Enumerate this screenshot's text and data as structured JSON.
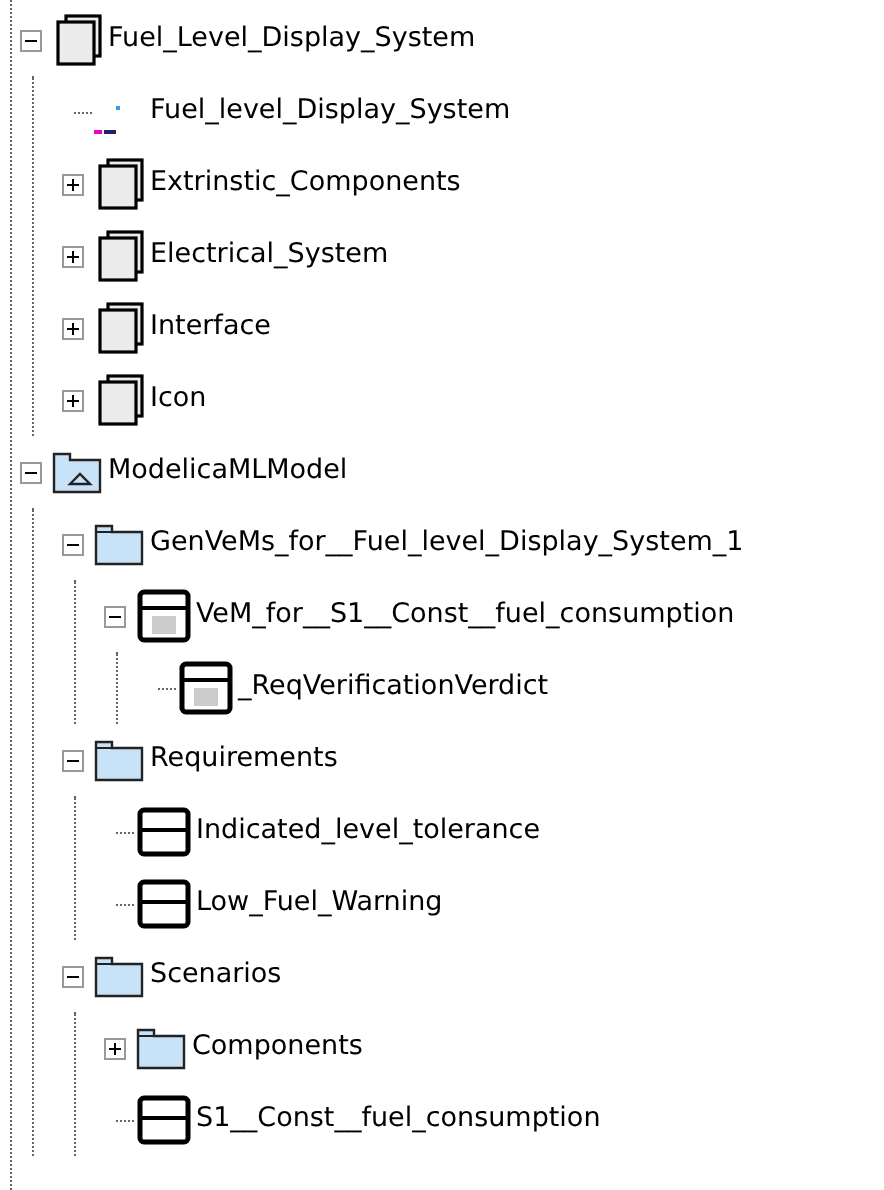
{
  "tree": [
    {
      "label": "Fuel_Level_Display_System",
      "kind": "stack",
      "expanded": true,
      "children": [
        {
          "label": "Fuel_level_Display_System",
          "kind": "diagram"
        },
        {
          "label": "Extrinstic_Components",
          "kind": "stack",
          "expanded": false
        },
        {
          "label": "Electrical_System",
          "kind": "stack",
          "expanded": false
        },
        {
          "label": "Interface",
          "kind": "stack",
          "expanded": false
        },
        {
          "label": "Icon",
          "kind": "stack",
          "expanded": false
        }
      ]
    },
    {
      "label": "ModelicaMLModel",
      "kind": "model",
      "expanded": true,
      "children": [
        {
          "label": "GenVeMs_for__Fuel_level_Display_System_1",
          "kind": "package",
          "expanded": true,
          "children": [
            {
              "label": "VeM_for__S1__Const__fuel_consumption",
              "kind": "vem",
              "expanded": true,
              "children": [
                {
                  "label": "_ReqVerificationVerdict",
                  "kind": "vem"
                }
              ]
            }
          ]
        },
        {
          "label": "Requirements",
          "kind": "package",
          "expanded": true,
          "children": [
            {
              "label": "Indicated_level_tolerance",
              "kind": "requirement"
            },
            {
              "label": "Low_Fuel_Warning",
              "kind": "requirement"
            }
          ]
        },
        {
          "label": "Scenarios",
          "kind": "package",
          "expanded": true,
          "children": [
            {
              "label": "Components",
              "kind": "package",
              "expanded": false
            },
            {
              "label": "S1__Const__fuel_consumption",
              "kind": "requirement"
            }
          ]
        }
      ]
    }
  ]
}
